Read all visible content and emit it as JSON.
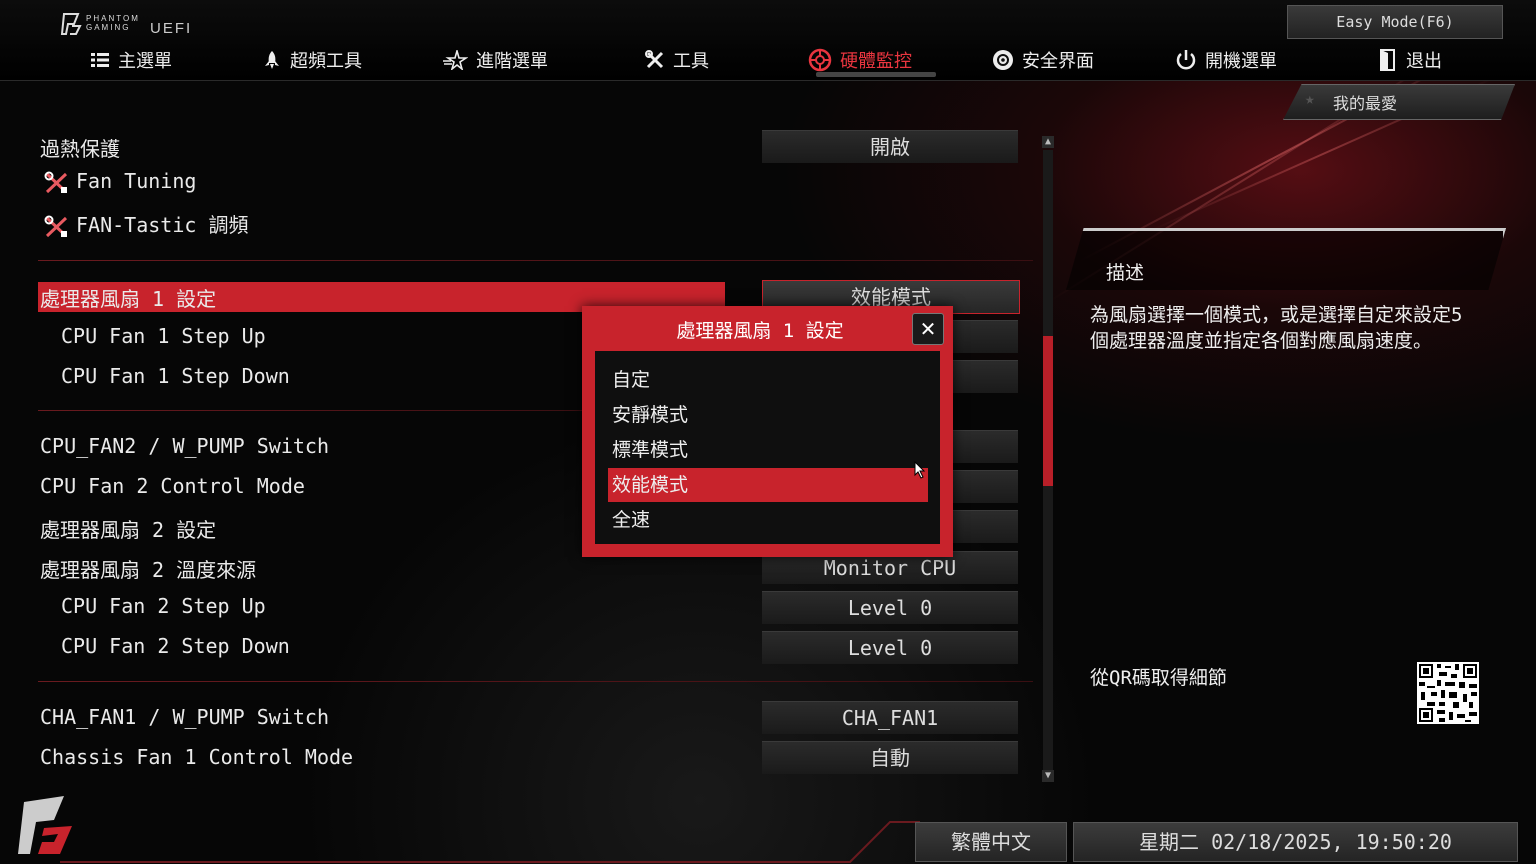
{
  "header": {
    "brand_line1": "PHANTOM",
    "brand_line2": "GAMING",
    "brand_suffix": "UEFI",
    "easy_mode": "Easy Mode(F6)",
    "favorites": "我的最愛",
    "menu": [
      {
        "label": "主選單",
        "icon": "list-icon"
      },
      {
        "label": "超頻工具",
        "icon": "rocket-icon"
      },
      {
        "label": "進階選單",
        "icon": "star-icon"
      },
      {
        "label": "工具",
        "icon": "tools-icon"
      },
      {
        "label": "硬體監控",
        "icon": "monitor-icon",
        "active": true
      },
      {
        "label": "安全界面",
        "icon": "shield-icon"
      },
      {
        "label": "開機選單",
        "icon": "power-icon"
      },
      {
        "label": "退出",
        "icon": "exit-icon"
      }
    ]
  },
  "settings": {
    "overheat": {
      "label": "過熱保護",
      "value": "開啟"
    },
    "fan_tuning": {
      "label": "Fan Tuning"
    },
    "fantastic": {
      "label": "FAN-Tastic 調頻"
    },
    "cpu_fan1_setting": {
      "label": "處理器風扇 1 設定",
      "value": "效能模式"
    },
    "cpu_fan1_step_up": {
      "label": "CPU Fan 1 Step Up",
      "value": "Level 0"
    },
    "cpu_fan1_step_down": {
      "label": "CPU Fan 1 Step Down",
      "value": ""
    },
    "cpu_fan2_switch": {
      "label": "CPU_FAN2 / W_PUMP Switch",
      "value": ""
    },
    "cpu_fan2_mode": {
      "label": "CPU Fan 2 Control Mode",
      "value": ""
    },
    "cpu_fan2_setting": {
      "label": "處理器風扇 2 設定",
      "value": ""
    },
    "cpu_fan2_temp": {
      "label": "處理器風扇 2 溫度來源",
      "value": "Monitor CPU"
    },
    "cpu_fan2_step_up": {
      "label": "CPU Fan 2 Step Up",
      "value": "Level 0"
    },
    "cpu_fan2_step_down": {
      "label": "CPU Fan 2 Step Down",
      "value": "Level 0"
    },
    "cha_fan1_switch": {
      "label": "CHA_FAN1 / W_PUMP Switch",
      "value": "CHA_FAN1"
    },
    "chassis_fan1_mode": {
      "label": "Chassis Fan 1 Control Mode",
      "value": "自動"
    }
  },
  "popup": {
    "title": "處理器風扇 1 設定",
    "close": "✕",
    "options": [
      "自定",
      "安靜模式",
      "標準模式",
      "效能模式",
      "全速"
    ],
    "selected_index": 3
  },
  "description": {
    "title": "描述",
    "text": "為風扇選擇一個模式，或是選擇自定來設定5個處理器溫度並指定各個對應風扇速度。",
    "qr_label": "從QR碼取得細節"
  },
  "footer": {
    "language": "繁體中文",
    "datetime": "星期二 02/18/2025, 19:50:20"
  },
  "colors": {
    "accent": "#c8232c"
  }
}
